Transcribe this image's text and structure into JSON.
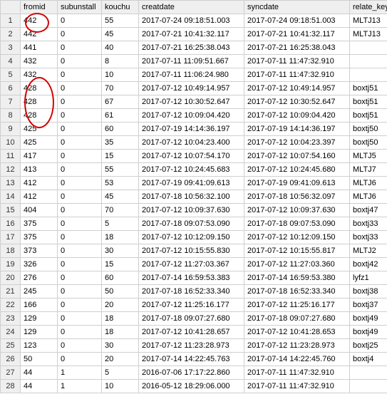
{
  "headers": {
    "fromid": "fromid",
    "subunstall": "subunstall",
    "kouchu": "kouchu",
    "creatdate": "creatdate",
    "syncdate": "syncdate",
    "relate_key": "relate_key"
  },
  "rows": [
    {
      "n": 1,
      "fromid": "442",
      "subunstall": "0",
      "kouchu": "55",
      "creatdate": "2017-07-24 09:18:51.003",
      "syncdate": "2017-07-24 09:18:51.003",
      "relate_key": "MLTJ13"
    },
    {
      "n": 2,
      "fromid": "442",
      "subunstall": "0",
      "kouchu": "45",
      "creatdate": "2017-07-21 10:41:32.117",
      "syncdate": "2017-07-21 10:41:32.117",
      "relate_key": "MLTJ13"
    },
    {
      "n": 3,
      "fromid": "441",
      "subunstall": "0",
      "kouchu": "40",
      "creatdate": "2017-07-21 16:25:38.043",
      "syncdate": "2017-07-21 16:25:38.043",
      "relate_key": ""
    },
    {
      "n": 4,
      "fromid": "432",
      "subunstall": "0",
      "kouchu": "8",
      "creatdate": "2017-07-11 11:09:51.667",
      "syncdate": "2017-07-11 11:47:32.910",
      "relate_key": ""
    },
    {
      "n": 5,
      "fromid": "432",
      "subunstall": "0",
      "kouchu": "10",
      "creatdate": "2017-07-11 11:06:24.980",
      "syncdate": "2017-07-11 11:47:32.910",
      "relate_key": ""
    },
    {
      "n": 6,
      "fromid": "428",
      "subunstall": "0",
      "kouchu": "70",
      "creatdate": "2017-07-12 10:49:14.957",
      "syncdate": "2017-07-12 10:49:14.957",
      "relate_key": "boxtj51"
    },
    {
      "n": 7,
      "fromid": "428",
      "subunstall": "0",
      "kouchu": "67",
      "creatdate": "2017-07-12 10:30:52.647",
      "syncdate": "2017-07-12 10:30:52.647",
      "relate_key": "boxtj51"
    },
    {
      "n": 8,
      "fromid": "428",
      "subunstall": "0",
      "kouchu": "61",
      "creatdate": "2017-07-12 10:09:04.420",
      "syncdate": "2017-07-12 10:09:04.420",
      "relate_key": "boxtj51"
    },
    {
      "n": 9,
      "fromid": "425",
      "subunstall": "0",
      "kouchu": "60",
      "creatdate": "2017-07-19 14:14:36.197",
      "syncdate": "2017-07-19 14:14:36.197",
      "relate_key": "boxtj50"
    },
    {
      "n": 10,
      "fromid": "425",
      "subunstall": "0",
      "kouchu": "35",
      "creatdate": "2017-07-12 10:04:23.400",
      "syncdate": "2017-07-12 10:04:23.397",
      "relate_key": "boxtj50"
    },
    {
      "n": 11,
      "fromid": "417",
      "subunstall": "0",
      "kouchu": "15",
      "creatdate": "2017-07-12 10:07:54.170",
      "syncdate": "2017-07-12 10:07:54.160",
      "relate_key": "MLTJ5"
    },
    {
      "n": 12,
      "fromid": "413",
      "subunstall": "0",
      "kouchu": "55",
      "creatdate": "2017-07-12 10:24:45.683",
      "syncdate": "2017-07-12 10:24:45.680",
      "relate_key": "MLTJ7"
    },
    {
      "n": 13,
      "fromid": "412",
      "subunstall": "0",
      "kouchu": "53",
      "creatdate": "2017-07-19 09:41:09.613",
      "syncdate": "2017-07-19 09:41:09.613",
      "relate_key": "MLTJ6"
    },
    {
      "n": 14,
      "fromid": "412",
      "subunstall": "0",
      "kouchu": "45",
      "creatdate": "2017-07-18 10:56:32.100",
      "syncdate": "2017-07-18 10:56:32.097",
      "relate_key": "MLTJ6"
    },
    {
      "n": 15,
      "fromid": "404",
      "subunstall": "0",
      "kouchu": "70",
      "creatdate": "2017-07-12 10:09:37.630",
      "syncdate": "2017-07-12 10:09:37.630",
      "relate_key": "boxtj47"
    },
    {
      "n": 16,
      "fromid": "375",
      "subunstall": "0",
      "kouchu": "5",
      "creatdate": "2017-07-18 09:07:53.090",
      "syncdate": "2017-07-18 09:07:53.090",
      "relate_key": "boxtj33"
    },
    {
      "n": 17,
      "fromid": "375",
      "subunstall": "0",
      "kouchu": "18",
      "creatdate": "2017-07-12 10:12:09.150",
      "syncdate": "2017-07-12 10:12:09.150",
      "relate_key": "boxtj33"
    },
    {
      "n": 18,
      "fromid": "373",
      "subunstall": "0",
      "kouchu": "30",
      "creatdate": "2017-07-12 10:15:55.830",
      "syncdate": "2017-07-12 10:15:55.817",
      "relate_key": "MLTJ2"
    },
    {
      "n": 19,
      "fromid": "326",
      "subunstall": "0",
      "kouchu": "15",
      "creatdate": "2017-07-12 11:27:03.367",
      "syncdate": "2017-07-12 11:27:03.360",
      "relate_key": "boxtj42"
    },
    {
      "n": 20,
      "fromid": "276",
      "subunstall": "0",
      "kouchu": "60",
      "creatdate": "2017-07-14 16:59:53.383",
      "syncdate": "2017-07-14 16:59:53.380",
      "relate_key": "lyfz1"
    },
    {
      "n": 21,
      "fromid": "245",
      "subunstall": "0",
      "kouchu": "50",
      "creatdate": "2017-07-18 16:52:33.340",
      "syncdate": "2017-07-18 16:52:33.340",
      "relate_key": "boxtj38"
    },
    {
      "n": 22,
      "fromid": "166",
      "subunstall": "0",
      "kouchu": "20",
      "creatdate": "2017-07-12 11:25:16.177",
      "syncdate": "2017-07-12 11:25:16.177",
      "relate_key": "boxtj37"
    },
    {
      "n": 23,
      "fromid": "129",
      "subunstall": "0",
      "kouchu": "18",
      "creatdate": "2017-07-18 09:07:27.680",
      "syncdate": "2017-07-18 09:07:27.680",
      "relate_key": "boxtj49"
    },
    {
      "n": 24,
      "fromid": "129",
      "subunstall": "0",
      "kouchu": "18",
      "creatdate": "2017-07-12 10:41:28.657",
      "syncdate": "2017-07-12 10:41:28.653",
      "relate_key": "boxtj49"
    },
    {
      "n": 25,
      "fromid": "123",
      "subunstall": "0",
      "kouchu": "30",
      "creatdate": "2017-07-12 11:23:28.973",
      "syncdate": "2017-07-12 11:23:28.973",
      "relate_key": "boxtj25"
    },
    {
      "n": 26,
      "fromid": "50",
      "subunstall": "0",
      "kouchu": "20",
      "creatdate": "2017-07-14 14:22:45.763",
      "syncdate": "2017-07-14 14:22:45.760",
      "relate_key": "boxtj4"
    },
    {
      "n": 27,
      "fromid": "44",
      "subunstall": "1",
      "kouchu": "5",
      "creatdate": "2016-07-06 17:17:22.860",
      "syncdate": "2017-07-11 11:47:32.910",
      "relate_key": ""
    },
    {
      "n": 28,
      "fromid": "44",
      "subunstall": "1",
      "kouchu": "10",
      "creatdate": "2016-05-12 18:29:06.000",
      "syncdate": "2017-07-11 11:47:32.910",
      "relate_key": ""
    }
  ],
  "annotations": {
    "color": "#d40000"
  }
}
